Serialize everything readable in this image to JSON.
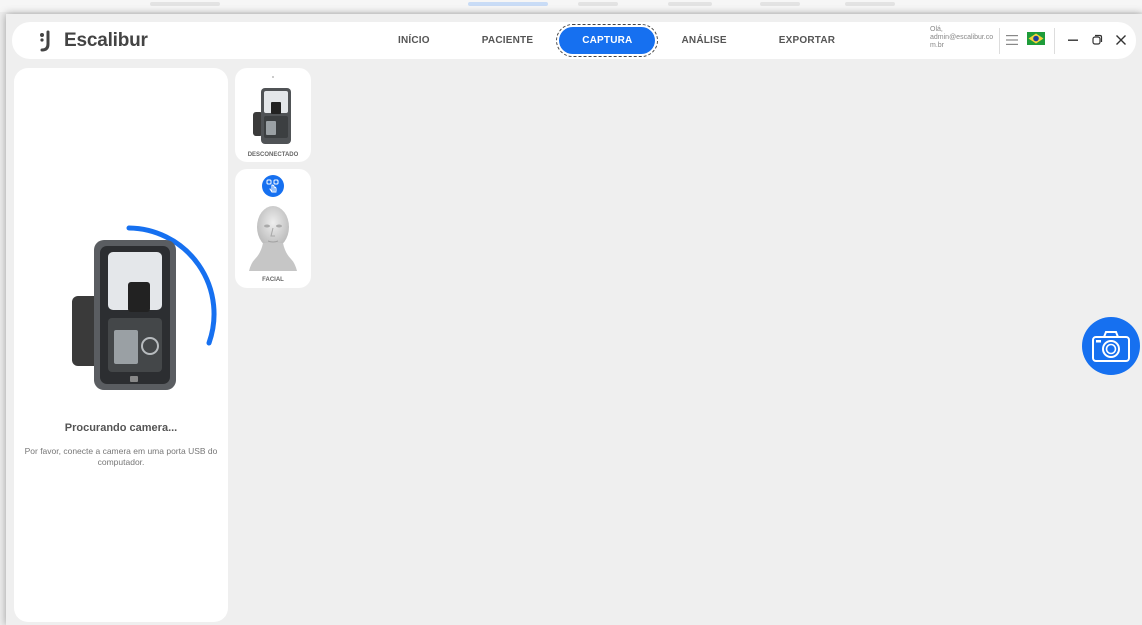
{
  "app": {
    "logo_text": "Escalibur"
  },
  "nav": {
    "items": [
      {
        "label": "INÍCIO",
        "active": false
      },
      {
        "label": "PACIENTE",
        "active": false
      },
      {
        "label": "CAPTURA",
        "active": true
      },
      {
        "label": "ANÁLISE",
        "active": false
      },
      {
        "label": "EXPORTAR",
        "active": false
      }
    ]
  },
  "user": {
    "greeting": "Olá,",
    "email": "admin@escalibur.com.br"
  },
  "camera_panel": {
    "status_title": "Procurando camera...",
    "status_description": "Por favor, conecte a camera em uma porta USB do computador."
  },
  "devices": [
    {
      "label": "DESCONECTADO"
    },
    {
      "label": "FACIAL"
    }
  ],
  "colors": {
    "accent": "#1670f0",
    "background": "#efefef",
    "panel": "#ffffff"
  },
  "icons": {
    "menu": "hamburger-menu-icon",
    "language": "brazil-flag-icon",
    "minimize": "minimize-icon",
    "restore": "restore-icon",
    "close": "close-icon",
    "capture": "camera-icon"
  }
}
